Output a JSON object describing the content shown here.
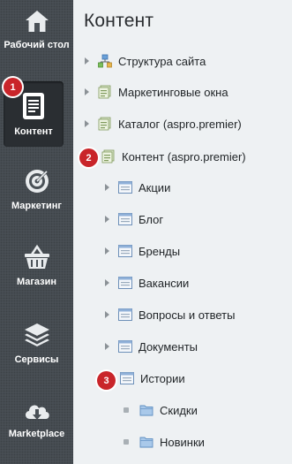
{
  "sidebar": {
    "items": [
      {
        "label": "Рабочий стол",
        "icon": "home-icon"
      },
      {
        "label": "Контент",
        "icon": "document-icon",
        "active": true
      },
      {
        "label": "Маркетинг",
        "icon": "target-icon"
      },
      {
        "label": "Магазин",
        "icon": "basket-icon"
      },
      {
        "label": "Сервисы",
        "icon": "layers-icon"
      },
      {
        "label": "Marketplace",
        "icon": "cloud-download-icon"
      }
    ]
  },
  "panel": {
    "title": "Контент",
    "tree": [
      {
        "label": "Структура сайта",
        "level": 0,
        "icon": "site-structure-icon"
      },
      {
        "label": "Маркетинговые окна",
        "level": 0,
        "icon": "iblock-type-icon"
      },
      {
        "label": "Каталог (aspro.premier)",
        "level": 0,
        "icon": "iblock-type-icon"
      },
      {
        "label": "Контент (aspro.premier)",
        "level": 0,
        "icon": "iblock-type-icon",
        "expanded": true
      },
      {
        "label": "Акции",
        "level": 1,
        "icon": "iblock-icon"
      },
      {
        "label": "Блог",
        "level": 1,
        "icon": "iblock-icon"
      },
      {
        "label": "Бренды",
        "level": 1,
        "icon": "iblock-icon"
      },
      {
        "label": "Вакансии",
        "level": 1,
        "icon": "iblock-icon"
      },
      {
        "label": "Вопросы и ответы",
        "level": 1,
        "icon": "iblock-icon"
      },
      {
        "label": "Документы",
        "level": 1,
        "icon": "iblock-icon"
      },
      {
        "label": "Истории",
        "level": 1,
        "icon": "iblock-icon",
        "expanded": true
      },
      {
        "label": "Скидки",
        "level": 2,
        "icon": "folder-icon"
      },
      {
        "label": "Новинки",
        "level": 2,
        "icon": "folder-icon"
      }
    ]
  },
  "badges": [
    "1",
    "2",
    "3"
  ],
  "colors": {
    "badge": "#c9252a",
    "sidebar": "#4a5157",
    "panel": "#eef1f3"
  }
}
